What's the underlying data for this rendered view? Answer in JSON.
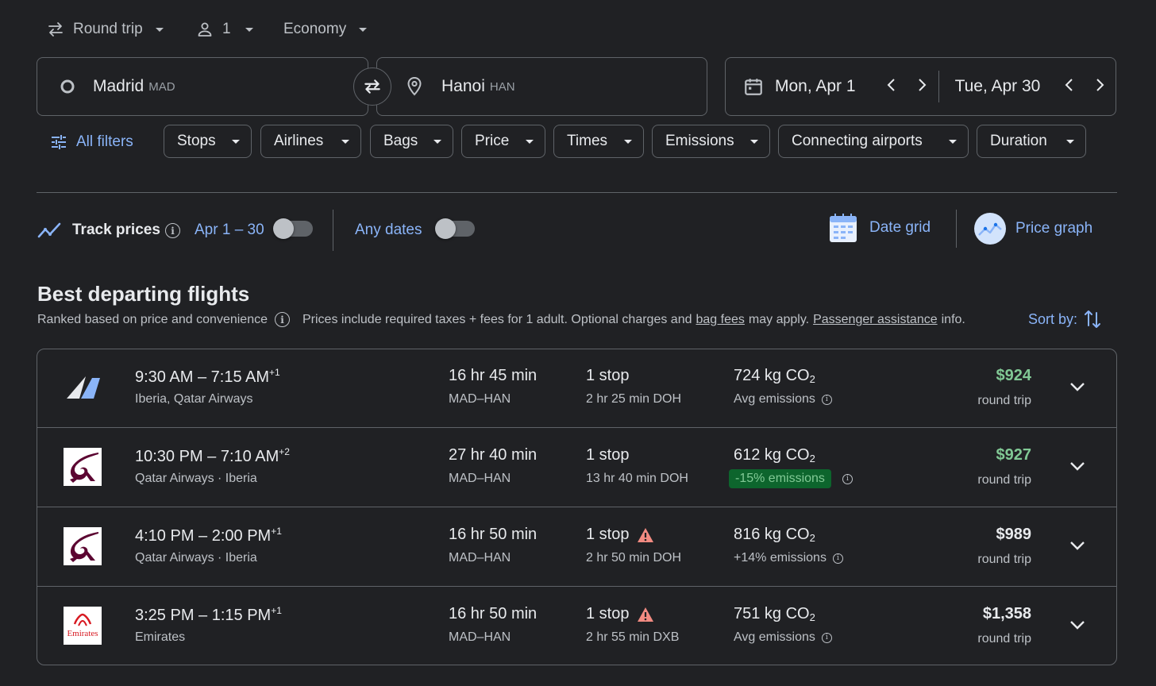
{
  "trip_options": {
    "trip_type": "Round trip",
    "passengers": "1",
    "cabin": "Economy"
  },
  "search": {
    "origin_city": "Madrid",
    "origin_code": "MAD",
    "destination_city": "Hanoi",
    "destination_code": "HAN",
    "depart_date": "Mon, Apr 1",
    "return_date": "Tue, Apr 30"
  },
  "filters": {
    "all_filters_label": "All filters",
    "chips": [
      "Stops",
      "Airlines",
      "Bags",
      "Price",
      "Times",
      "Emissions",
      "Connecting airports",
      "Duration"
    ]
  },
  "tracking": {
    "track_prices_label": "Track prices",
    "date_range": "Apr 1 – 30",
    "track_prices_enabled": false,
    "any_dates_label": "Any dates",
    "any_dates_enabled": false,
    "date_grid_label": "Date grid",
    "price_graph_label": "Price graph"
  },
  "section": {
    "title": "Best departing flights",
    "ranked_text": "Ranked based on price and convenience",
    "prices_text": "Prices include required taxes + fees for 1 adult. Optional charges and",
    "bag_fees_link": "bag fees",
    "may_apply_text": "may apply.",
    "assistance_link": "Passenger assistance",
    "info_text": "info.",
    "sort_label": "Sort by:"
  },
  "flights": [
    {
      "logo": "iberia-logo",
      "depart": "9:30 AM",
      "arrive": "7:15 AM",
      "day_offset": "+1",
      "airlines": "Iberia, Qatar Airways",
      "duration": "16 hr 45 min",
      "route": "MAD–HAN",
      "stops": "1 stop",
      "warning": false,
      "layover": "2 hr 25 min DOH",
      "co2_value": "724 kg CO",
      "co2_sub": "2",
      "emissions": "Avg emissions",
      "emissions_badge": false,
      "price": "$924",
      "price_green": true,
      "price_type": "round trip"
    },
    {
      "logo": "qatar-logo",
      "depart": "10:30 PM",
      "arrive": "7:10 AM",
      "day_offset": "+2",
      "airlines": "Qatar Airways · Iberia",
      "duration": "27 hr 40 min",
      "route": "MAD–HAN",
      "stops": "1 stop",
      "warning": false,
      "layover": "13 hr 40 min DOH",
      "co2_value": "612 kg CO",
      "co2_sub": "2",
      "emissions": "-15% emissions",
      "emissions_badge": true,
      "price": "$927",
      "price_green": true,
      "price_type": "round trip"
    },
    {
      "logo": "qatar-logo",
      "depart": "4:10 PM",
      "arrive": "2:00 PM",
      "day_offset": "+1",
      "airlines": "Qatar Airways · Iberia",
      "duration": "16 hr 50 min",
      "route": "MAD–HAN",
      "stops": "1 stop",
      "warning": true,
      "layover": "2 hr 50 min DOH",
      "co2_value": "816 kg CO",
      "co2_sub": "2",
      "emissions": "+14% emissions",
      "emissions_badge": false,
      "price": "$989",
      "price_green": false,
      "price_type": "round trip"
    },
    {
      "logo": "emirates-logo",
      "logo_text": "Emirates",
      "depart": "3:25 PM",
      "arrive": "1:15 PM",
      "day_offset": "+1",
      "airlines": "Emirates",
      "duration": "16 hr 50 min",
      "route": "MAD–HAN",
      "stops": "1 stop",
      "warning": true,
      "layover": "2 hr 55 min DXB",
      "co2_value": "751 kg CO",
      "co2_sub": "2",
      "emissions": "Avg emissions",
      "emissions_badge": false,
      "price": "$1,358",
      "price_green": false,
      "price_type": "round trip"
    }
  ],
  "colors": {
    "background": "#202124",
    "accent": "#8ab4f8",
    "good_price": "#81c995",
    "border": "#5f6368",
    "warning": "#f28b82"
  }
}
